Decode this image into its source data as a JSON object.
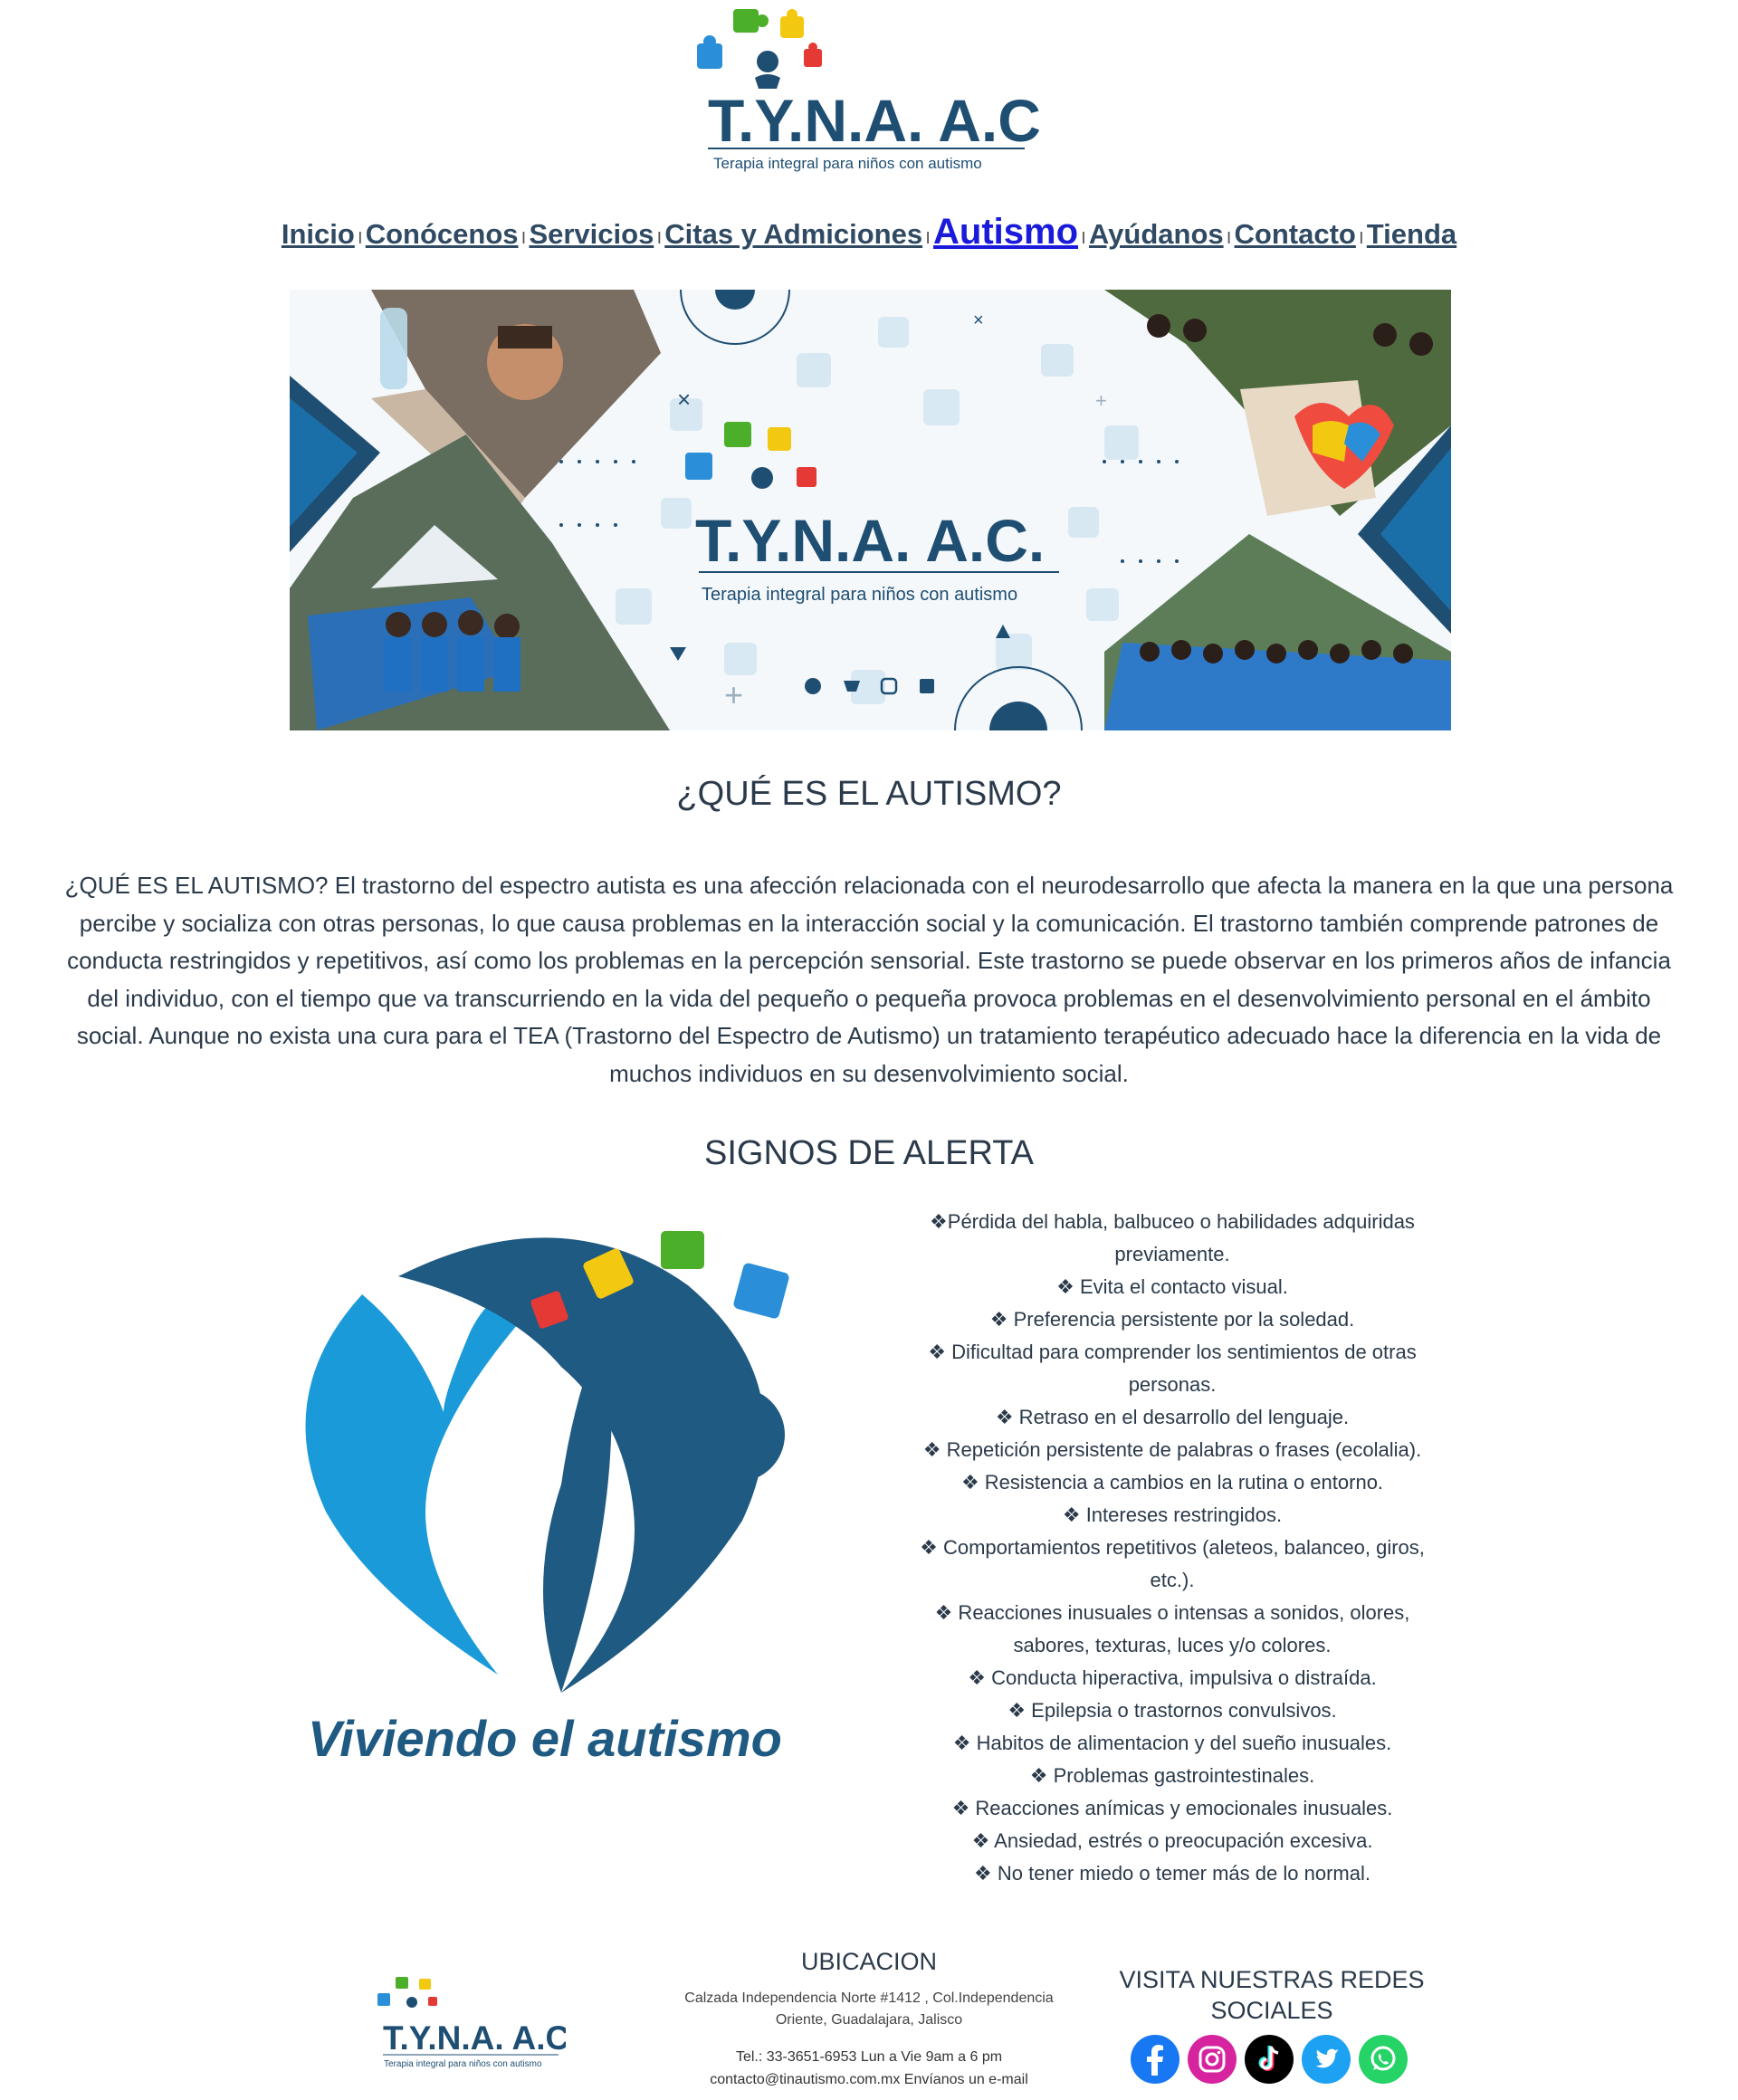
{
  "header": {
    "logo_title": "T.Y.N.A. A.C.",
    "logo_tagline": "Terapia integral para niños con autismo"
  },
  "nav": {
    "items": [
      "Inicio",
      "Conócenos",
      "Servicios",
      "Citas y Admiciones",
      "Autismo",
      "Ayúdanos",
      "Contacto",
      "Tienda"
    ],
    "active": "Autismo",
    "active_color": "#1a1adb"
  },
  "banner": {
    "logo_title": "T.Y.N.A. A.C.",
    "logo_tagline": "Terapia integral para niños con autismo",
    "social_icons": [
      "whatsapp-icon",
      "twitter-icon",
      "instagram-icon",
      "facebook-icon"
    ]
  },
  "main": {
    "what_title": "¿QUÉ ES EL AUTISMO?",
    "what_text_lines": [
      "¿QUÉ ES EL AUTISMO? El trastorno del espectro autista es una afección relacionada con el neurodesarrollo que afecta la manera en la que una persona",
      "percibe y socializa con otras personas, lo que causa problemas en la interacción social y la comunicación. El trastorno también comprende patrones de",
      "conducta restringidos y repetitivos, así como los problemas en la percepción sensorial. Este trastorno se puede observar en los primeros años de infancia",
      "del individuo, con el tiempo que va transcurriendo en la vida del pequeño o pequeña provoca problemas en el desenvolvimiento personal en el ámbito",
      "social. Aunque no exista una cura para el TEA (Trastorno del Espectro de Autismo) un tratamiento terapéutico adecuado hace la diferencia en la vida de",
      "muchos individuos en su desenvolvimiento social."
    ],
    "signs_title": "SIGNOS DE ALERTA",
    "logo2_caption": "Viviendo el autismo",
    "signs_lines": [
      "❖Pérdida del habla, balbuceo o habilidades adquiridas",
      "previamente.",
      "❖ Evita el contacto visual.",
      "❖ Preferencia persistente por la soledad.",
      "❖ Dificultad para comprender los sentimientos de otras",
      "personas.",
      "❖ Retraso en el desarrollo del lenguaje.",
      "❖ Repetición persistente de palabras o frases (ecolalia).",
      "❖ Resistencia a cambios en la rutina o entorno.",
      "❖ Intereses restringidos.",
      "❖ Comportamientos repetitivos (aleteos, balanceo, giros,",
      "etc.).",
      "❖ Reacciones inusuales o intensas a sonidos, olores,",
      "sabores, texturas, luces y/o colores.",
      "❖ Conducta hiperactiva, impulsiva o distraída.",
      "❖ Epilepsia o trastornos convulsivos.",
      "❖ Habitos de alimentacion y del sueño inusuales.",
      "❖ Problemas gastrointestinales.",
      "❖ Reacciones anímicas y emocionales inusuales.",
      "❖ Ansiedad, estrés o preocupación excesiva.",
      "❖ No tener miedo o temer más de lo normal."
    ]
  },
  "footer": {
    "logo_title": "T.Y.N.A. A.C.",
    "logo_tagline": "Terapia integral para niños con autismo",
    "ubicacion_title": "UBICACION",
    "address_line1": "Calzada Independencia Norte #1412 , Col.Independencia",
    "address_line2": "Oriente, Guadalajara, Jalisco",
    "phone_line": "Tel.: 33-3651-6953 Lun a Vie 9am a 6 pm",
    "email": "contacto@tinautismo.com.mx",
    "email_cta": "Envíanos un e-mail",
    "social_title_line1": "VISITA NUESTRAS REDES",
    "social_title_line2": "SOCIALES",
    "socials": [
      {
        "icon": "facebook-icon",
        "color": "#1877f2"
      },
      {
        "icon": "instagram-icon",
        "color": "#d6249f"
      },
      {
        "icon": "tiktok-icon",
        "color": "#000000"
      },
      {
        "icon": "twitter-icon",
        "color": "#1da1f2"
      },
      {
        "icon": "whatsapp-icon",
        "color": "#25d366"
      }
    ]
  },
  "colors": {
    "brand_navy": "#1f4e73",
    "brand_blue": "#1e90d6",
    "puzzle_green": "#4caf2a",
    "puzzle_yellow": "#f2c811",
    "puzzle_red": "#e53935",
    "puzzle_blue": "#2a8fd8"
  }
}
